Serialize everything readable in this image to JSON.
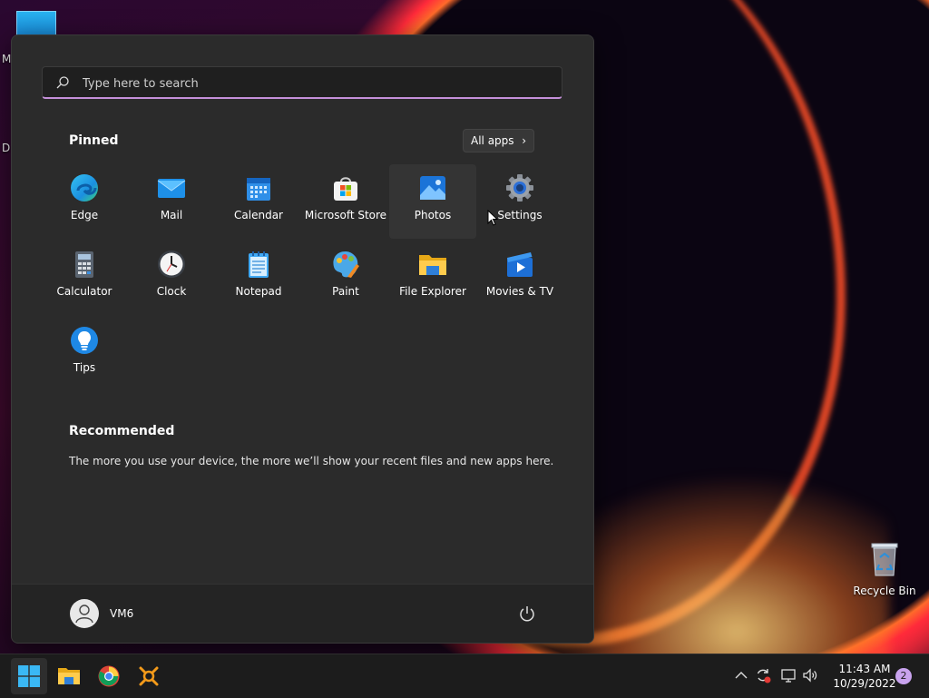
{
  "desktop": {
    "fragment_m": "M",
    "fragment_d": "D",
    "recycle_bin": "Recycle Bin"
  },
  "start_menu": {
    "search_placeholder": "Type here to search",
    "pinned_title": "Pinned",
    "all_apps_label": "All apps",
    "pinned": [
      {
        "label": "Edge",
        "icon": "edge-icon"
      },
      {
        "label": "Mail",
        "icon": "mail-icon"
      },
      {
        "label": "Calendar",
        "icon": "calendar-icon"
      },
      {
        "label": "Microsoft Store",
        "icon": "store-icon"
      },
      {
        "label": "Photos",
        "icon": "photos-icon"
      },
      {
        "label": "Settings",
        "icon": "gear-icon"
      },
      {
        "label": "Calculator",
        "icon": "calculator-icon"
      },
      {
        "label": "Clock",
        "icon": "clock-icon"
      },
      {
        "label": "Notepad",
        "icon": "notepad-icon"
      },
      {
        "label": "Paint",
        "icon": "paint-icon"
      },
      {
        "label": "File Explorer",
        "icon": "folder-icon"
      },
      {
        "label": "Movies & TV",
        "icon": "movies-icon"
      },
      {
        "label": "Tips",
        "icon": "lightbulb-icon"
      }
    ],
    "recommended_title": "Recommended",
    "recommended_text": "The more you use your device, the more we’ll show your recent files and new apps here.",
    "user_name": "VM6"
  },
  "taskbar": {
    "time": "11:43 AM",
    "date": "10/29/2022",
    "notification_count": "2"
  },
  "colors": {
    "accent": "#c48fd9",
    "menu_bg": "#2b2b2b",
    "taskbar_bg": "#1c1c1c"
  }
}
